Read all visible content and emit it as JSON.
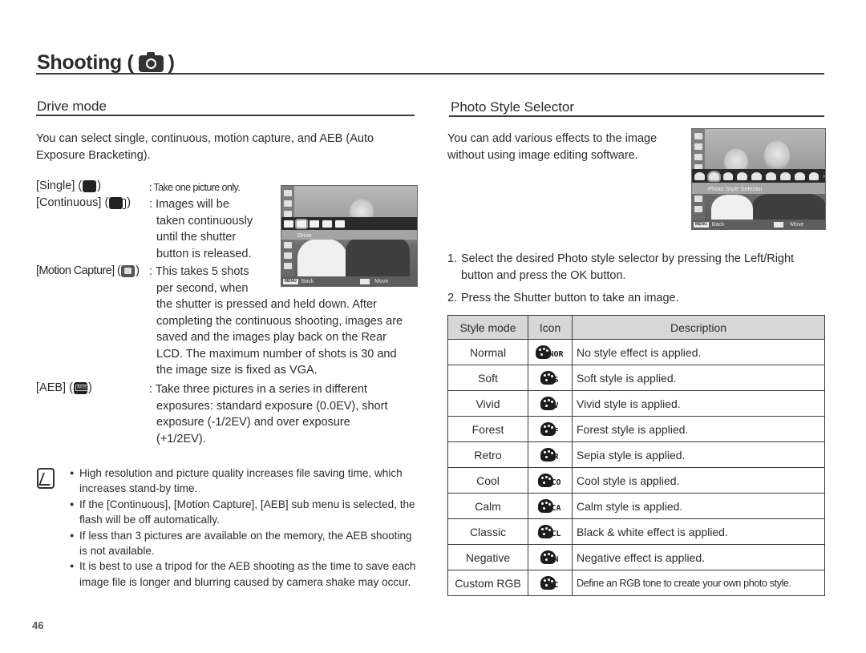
{
  "page": {
    "title": "Shooting (",
    "title_close": ")",
    "title_icon": "camera-icon",
    "page_number": "46"
  },
  "drive_mode": {
    "heading": "Drive mode",
    "intro": "You can select single, continuous, motion capture, and AEB (Auto Exposure Bracketing).",
    "options": [
      {
        "label_open": "[Single] (",
        "label_close": ")",
        "icon": "single-shot-icon",
        "sep": ":",
        "desc": "Take one picture only."
      },
      {
        "label_open": "[Continuous] (",
        "label_close": ")",
        "icon": "continuous-shot-icon",
        "sep": ":",
        "desc_lines": [
          "Images will be",
          "taken continuously",
          "until the shutter",
          "button is released."
        ]
      },
      {
        "label_open": "[Motion Capture] (",
        "label_close": ")",
        "icon": "motion-capture-icon",
        "sep": ":",
        "desc_lines": [
          "This takes 5 shots",
          "per second, when"
        ],
        "desc_cont": "the shutter is pressed and held down. After completing the continuous shooting, images are saved and the images play back on the Rear LCD. The maximum number of shots is 30 and the image size is fixed as VGA."
      },
      {
        "label_open": "[AEB] (",
        "label_close": ")",
        "icon": "aeb-icon",
        "sep": ":",
        "desc": "Take three pictures in a series in different exposures: standard exposure (0.0EV), short exposure (-1/2EV) and over exposure (+1/2EV)."
      }
    ],
    "screen": {
      "menu_label": "Drive",
      "footer_back_key": "MENU",
      "footer_back": "Back",
      "footer_move": "Move"
    },
    "notes": [
      "High resolution and picture quality increases file saving time, which increases stand-by time.",
      "If the [Continuous], [Motion Capture], [AEB] sub menu is selected, the flash will be off automatically.",
      "If less than 3 pictures are available on the memory, the AEB shooting is not available.",
      "It is best to use a tripod for the AEB shooting as the time to save each image file is longer and blurring caused by camera shake may occur."
    ]
  },
  "photo_style": {
    "heading": "Photo Style Selector",
    "intro": "You can add various effects to the image without using image editing software.",
    "screen": {
      "menu_label": "Photo Style Selector",
      "footer_back_key": "MENU",
      "footer_back": "Back",
      "footer_move": "Move"
    },
    "steps": [
      {
        "num": "1.",
        "text": "Select the desired Photo style selector by pressing the Left/Right button and press the OK button."
      },
      {
        "num": "2.",
        "text": "Press the Shutter button to take an image."
      }
    ],
    "table": {
      "headers": [
        "Style mode",
        "Icon",
        "Description"
      ],
      "rows": [
        {
          "mode": "Normal",
          "icon": "style-normal-icon",
          "tag": "NOR",
          "desc": "No style effect is applied."
        },
        {
          "mode": "Soft",
          "icon": "style-soft-icon",
          "tag": "S",
          "desc": "Soft style is applied."
        },
        {
          "mode": "Vivid",
          "icon": "style-vivid-icon",
          "tag": "V",
          "desc": "Vivid style is applied."
        },
        {
          "mode": "Forest",
          "icon": "style-forest-icon",
          "tag": "F",
          "desc": "Forest style is applied."
        },
        {
          "mode": "Retro",
          "icon": "style-retro-icon",
          "tag": "R",
          "desc": "Sepia style is applied."
        },
        {
          "mode": "Cool",
          "icon": "style-cool-icon",
          "tag": "CO",
          "desc": "Cool style is applied."
        },
        {
          "mode": "Calm",
          "icon": "style-calm-icon",
          "tag": "CA",
          "desc": "Calm style is applied."
        },
        {
          "mode": "Classic",
          "icon": "style-classic-icon",
          "tag": "CL",
          "desc": "Black & white effect is applied."
        },
        {
          "mode": "Negative",
          "icon": "style-negative-icon",
          "tag": "N",
          "desc": "Negative effect is applied."
        },
        {
          "mode": "Custom RGB",
          "icon": "style-custom-rgb-icon",
          "tag": "C",
          "desc": "Define an RGB tone to create your own photo style."
        }
      ]
    }
  }
}
